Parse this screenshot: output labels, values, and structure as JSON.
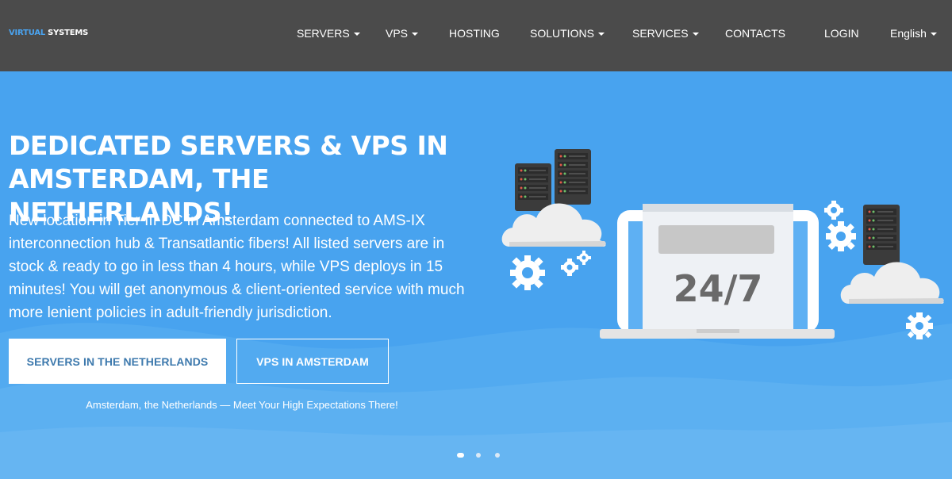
{
  "brand": {
    "part1": "VIRTUAL",
    "part2": "SYSTEMS"
  },
  "nav": {
    "items": [
      {
        "label": "SERVERS",
        "dropdown": true
      },
      {
        "label": "VPS",
        "dropdown": true
      },
      {
        "label": "HOSTING",
        "dropdown": false
      },
      {
        "label": "SOLUTIONS",
        "dropdown": true
      },
      {
        "label": "SERVICES",
        "dropdown": true
      },
      {
        "label": "CONTACTS",
        "dropdown": false
      },
      {
        "label": "LOGIN",
        "dropdown": false
      },
      {
        "label": "English",
        "dropdown": true
      }
    ]
  },
  "hero": {
    "headline_line1": "DEDICATED SERVERS & VPS IN",
    "headline_line2": "AMSTERDAM, THE NETHERLANDS!",
    "lead": "New location in Tier III DC in Amsterdam connected to AMS-IX interconnection hub & Transatlantic fibers! All listed servers are in stock & ready to go in less than 4 hours, while VPS deploys in 15 minutes! You will get anonymous & client-oriented service with much more lenient policies in adult-friendly jurisdiction.",
    "primary_button": "SERVERS IN THE NETHERLANDS",
    "secondary_button": "VPS IN AMSTERDAM",
    "tagline": "Amsterdam, the Netherlands — Meet Your High Expectations There!",
    "illustration_text": "24/7",
    "slider": {
      "slides": 3,
      "active": 1
    }
  },
  "colors": {
    "nav_bg": "#4b4b4b",
    "hero_bg": "#48a3ef",
    "accent": "#4aa3ef",
    "button_text": "#3d79ad"
  },
  "icons": [
    "server-rack-icon",
    "cloud-icon",
    "gear-icon",
    "laptop-icon"
  ]
}
